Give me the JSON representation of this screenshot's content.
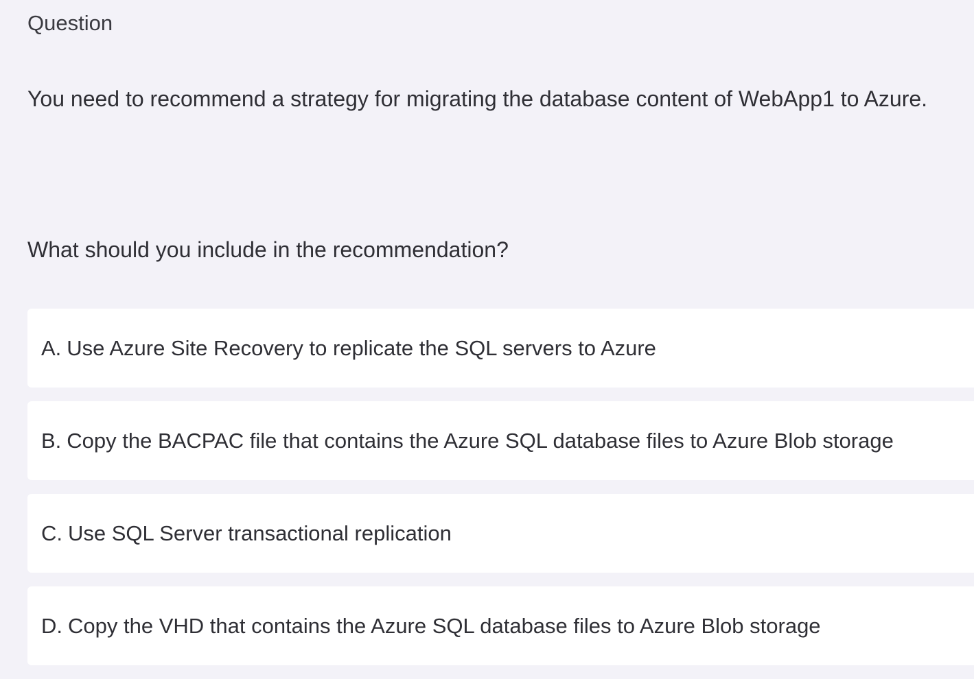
{
  "header": {
    "section_label": "Question"
  },
  "question": {
    "text": "You need to recommend a strategy for migrating the database content of WebApp1 to Azure.",
    "prompt": "What should you include in the recommendation?"
  },
  "options": [
    {
      "letter": "A.",
      "text": "Use Azure Site Recovery to replicate the SQL servers to Azure"
    },
    {
      "letter": "B.",
      "text": "Copy the BACPAC file that contains the Azure SQL database files to Azure Blob storage"
    },
    {
      "letter": "C.",
      "text": "Use SQL Server transactional replication"
    },
    {
      "letter": "D.",
      "text": "Copy the VHD that contains the Azure SQL database files to Azure Blob storage"
    }
  ]
}
